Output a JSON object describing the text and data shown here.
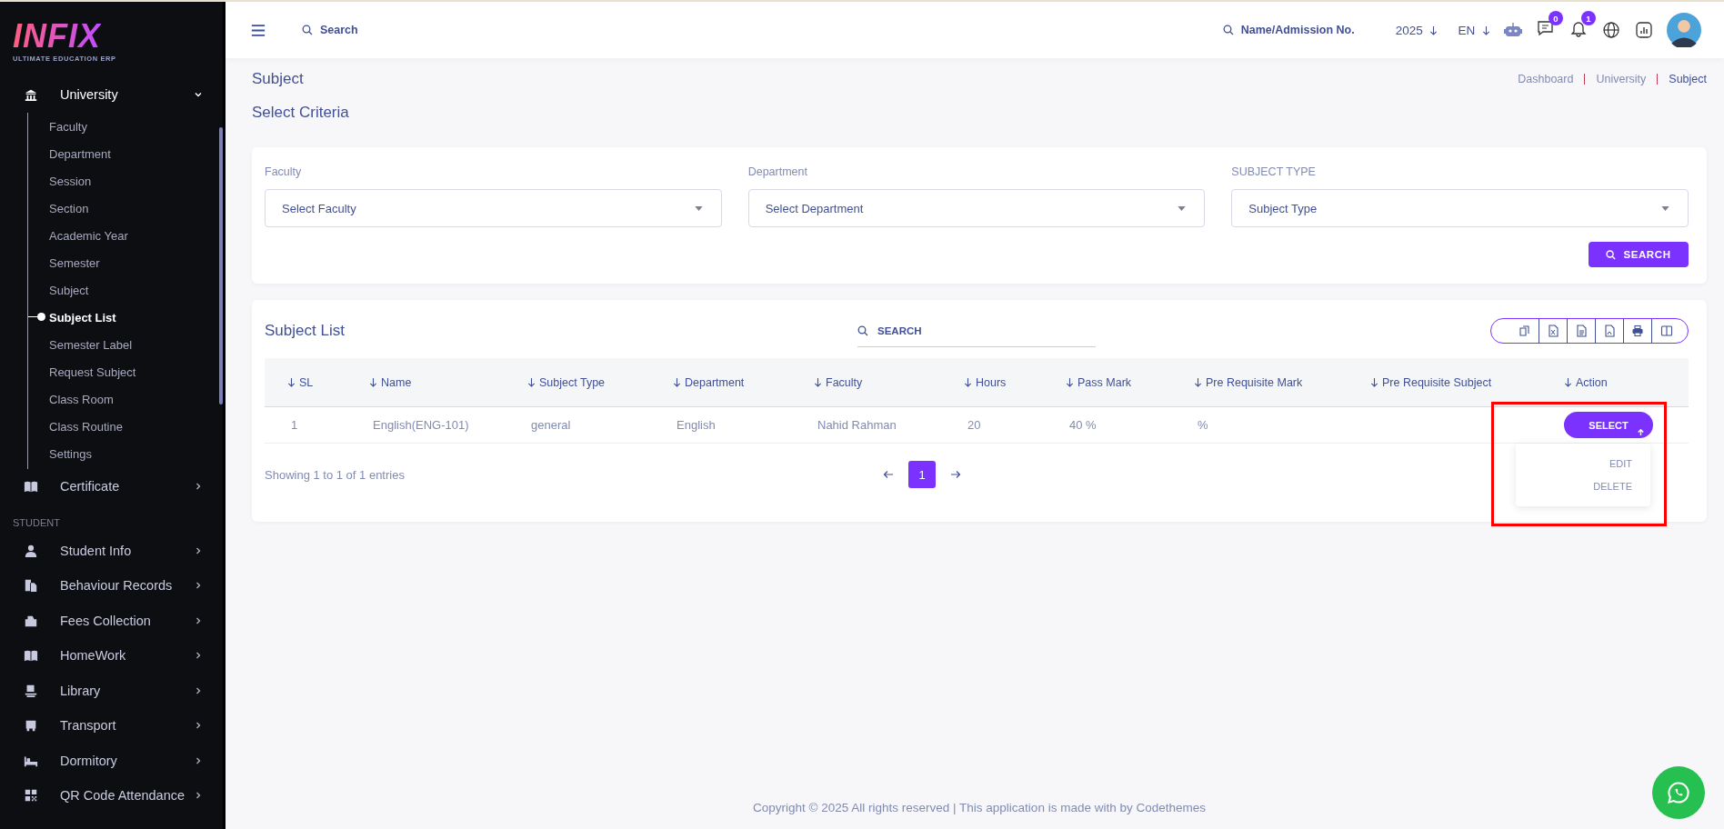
{
  "sidebar": {
    "logo": {
      "wordmark": "INFIX",
      "tagline": "ULTIMATE EDUCATION ERP"
    },
    "groups": [
      {
        "items": [
          {
            "label": "University",
            "expanded": true,
            "children": [
              {
                "label": "Faculty",
                "selected": false
              },
              {
                "label": "Department",
                "selected": false
              },
              {
                "label": "Session",
                "selected": false
              },
              {
                "label": "Section",
                "selected": false
              },
              {
                "label": "Academic Year",
                "selected": false
              },
              {
                "label": "Semester",
                "selected": false
              },
              {
                "label": "Subject",
                "selected": false
              },
              {
                "label": "Subject List",
                "selected": true
              },
              {
                "label": "Semester Label",
                "selected": false
              },
              {
                "label": "Request Subject",
                "selected": false
              },
              {
                "label": "Class Room",
                "selected": false
              },
              {
                "label": "Class Routine",
                "selected": false
              },
              {
                "label": "Settings",
                "selected": false
              }
            ]
          },
          {
            "label": "Certificate",
            "expanded": false
          }
        ]
      },
      {
        "heading": "STUDENT",
        "items": [
          {
            "label": "Student Info",
            "expanded": false
          },
          {
            "label": "Behaviour Records",
            "expanded": false
          },
          {
            "label": "Fees Collection",
            "expanded": false
          },
          {
            "label": "HomeWork",
            "expanded": false
          },
          {
            "label": "Library",
            "expanded": false
          },
          {
            "label": "Transport",
            "expanded": false
          },
          {
            "label": "Dormitory",
            "expanded": false
          },
          {
            "label": "QR Code Attendance",
            "expanded": false
          }
        ]
      }
    ]
  },
  "header": {
    "search": {
      "placeholder": "Search"
    },
    "student_search": {
      "placeholder": "Name/Admission No."
    },
    "year": "2025",
    "language": "EN",
    "messages_badge": "0",
    "notifications_badge": "1"
  },
  "page": {
    "title": "Subject",
    "breadcrumbs": [
      {
        "label": "Dashboard",
        "current": false
      },
      {
        "label": "University",
        "current": false
      },
      {
        "label": "Subject",
        "current": true
      }
    ]
  },
  "criteria": {
    "title": "Select Criteria",
    "fields": [
      {
        "label": "Faculty",
        "placeholder": "Select Faculty"
      },
      {
        "label": "Department",
        "placeholder": "Select Department"
      },
      {
        "label": "SUBJECT TYPE",
        "placeholder": "Subject Type"
      }
    ],
    "search_button": "SEARCH"
  },
  "subject_list": {
    "title": "Subject List",
    "search": {
      "placeholder": "SEARCH"
    },
    "columns": [
      "SL",
      "Name",
      "Subject Type",
      "Department",
      "Faculty",
      "Hours",
      "Pass Mark",
      "Pre Requisite Mark",
      "Pre Requisite Subject",
      "Action"
    ],
    "rows": [
      {
        "cells": [
          "1",
          "English(ENG-101)",
          "general",
          "English",
          "Nahid Rahman",
          "20",
          "40 %",
          "%",
          ""
        ],
        "action": {
          "label": "SELECT",
          "expanded": true,
          "menu": [
            "EDIT",
            "DELETE"
          ]
        }
      }
    ],
    "info": "Showing 1 to 1 of 1 entries",
    "pages": [
      {
        "label": "1",
        "selected": true
      }
    ]
  },
  "footer": {
    "copyright": "Copyright © 2025 All rights reserved | This application is made with by Codethemes"
  }
}
